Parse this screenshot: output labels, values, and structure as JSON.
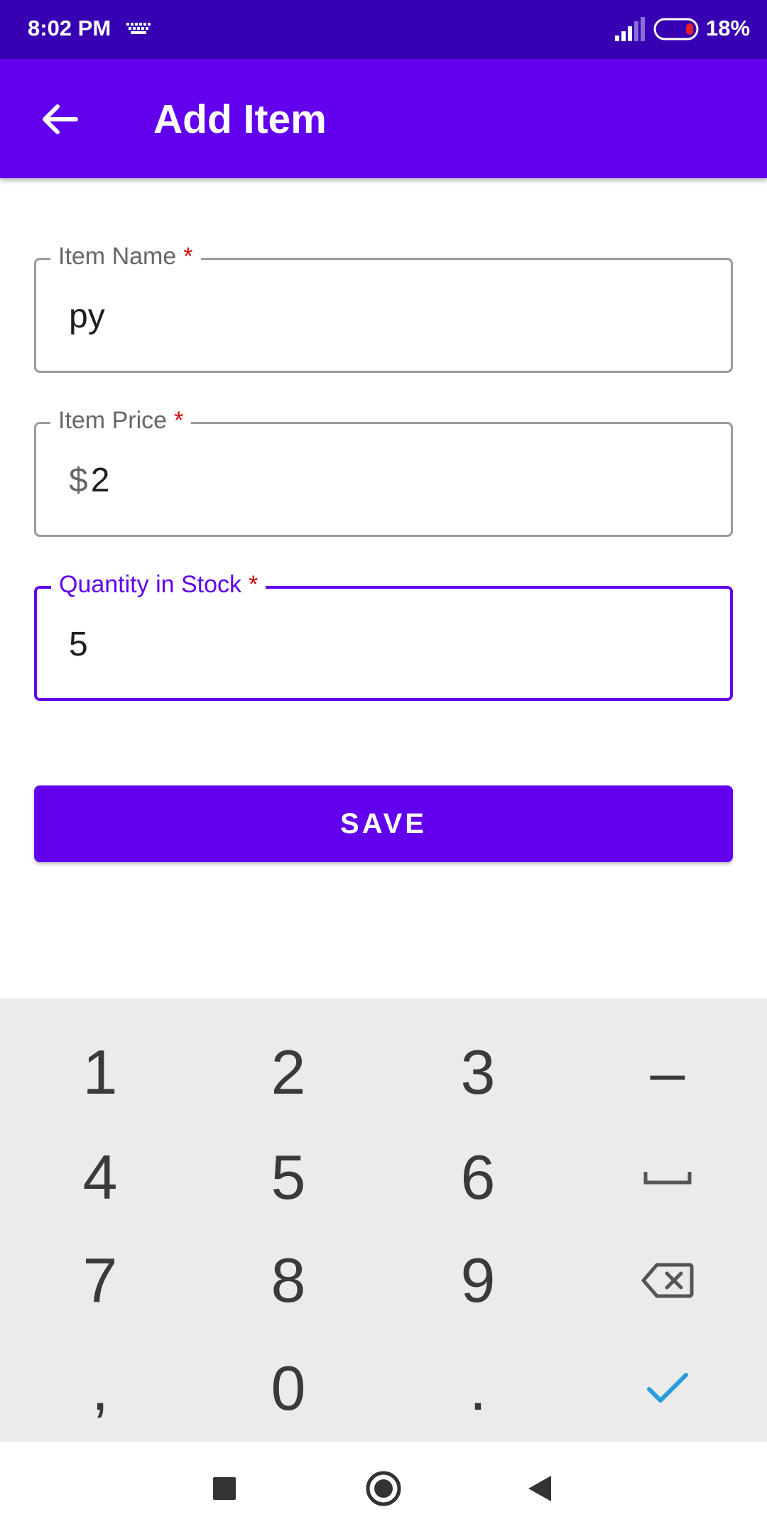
{
  "status_bar": {
    "time": "8:02 PM",
    "battery": "18%",
    "icons": [
      "keyboard-icon",
      "signal-icon",
      "battery-icon"
    ]
  },
  "app_bar": {
    "title": "Add Item",
    "back_icon": "arrow-back-icon"
  },
  "form": {
    "item_name": {
      "label": "Item Name",
      "required_mark": "*",
      "value": "py"
    },
    "item_price": {
      "label": "Item Price",
      "required_mark": "*",
      "prefix": "$",
      "value": "2"
    },
    "quantity": {
      "label": "Quantity in Stock",
      "required_mark": "*",
      "value": "5"
    },
    "save_label": "SAVE"
  },
  "keyboard": {
    "row1": [
      "1",
      "2",
      "3",
      "–"
    ],
    "row2": [
      "4",
      "5",
      "6"
    ],
    "row3": [
      "7",
      "8",
      "9"
    ],
    "row4": [
      ",",
      "0",
      "."
    ],
    "special_keys": [
      "space-icon",
      "backspace-icon",
      "checkmark-icon"
    ]
  },
  "nav_bar": {
    "icons": [
      "recents-icon",
      "home-icon",
      "back-icon"
    ]
  },
  "colors": {
    "status_bar": "#3700b3",
    "primary": "#6200ee",
    "required": "#d50000",
    "keyboard_bg": "#ebebeb",
    "enter_key": "#2a9cdc"
  }
}
